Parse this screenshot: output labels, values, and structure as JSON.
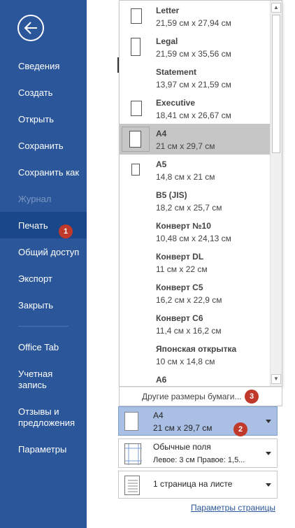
{
  "sidebar": {
    "items": [
      {
        "label": "Сведения"
      },
      {
        "label": "Создать"
      },
      {
        "label": "Открыть"
      },
      {
        "label": "Сохранить"
      },
      {
        "label": "Сохранить как"
      },
      {
        "label": "Журнал"
      },
      {
        "label": "Печать"
      },
      {
        "label": "Общий доступ"
      },
      {
        "label": "Экспорт"
      },
      {
        "label": "Закрыть"
      },
      {
        "label": "Office Tab"
      },
      {
        "label": "Учетная запись"
      },
      {
        "label": "Отзывы и предложения"
      },
      {
        "label": "Параметры"
      }
    ]
  },
  "badges": {
    "one": "1",
    "two": "2",
    "three": "3"
  },
  "paper_sizes": [
    {
      "name": "Letter",
      "size": "21,59 см x 27,94 см"
    },
    {
      "name": "Legal",
      "size": "21,59 см x 35,56 см"
    },
    {
      "name": "Statement",
      "size": "13,97 см x 21,59 см"
    },
    {
      "name": "Executive",
      "size": "18,41 см x 26,67 см"
    },
    {
      "name": "A4",
      "size": "21 см x 29,7 см"
    },
    {
      "name": "A5",
      "size": "14,8 см x 21 см"
    },
    {
      "name": "B5 (JIS)",
      "size": "18,2 см x 25,7 см"
    },
    {
      "name": "Конверт №10",
      "size": "10,48 см x 24,13 см"
    },
    {
      "name": "Конверт DL",
      "size": "11 см x 22 см"
    },
    {
      "name": "Конверт C5",
      "size": "16,2 см x 22,9 см"
    },
    {
      "name": "Конверт C6",
      "size": "11,4 см x 16,2 см"
    },
    {
      "name": "Японская открытка",
      "size": "10 см x 14,8 см"
    },
    {
      "name": "A6",
      "size": ""
    }
  ],
  "more_sizes_label": "Другие размеры бумаги...",
  "settings": {
    "paper": {
      "line1": "A4",
      "line2": "21 см x 29,7 см"
    },
    "margins": {
      "line1": "Обычные поля",
      "line2": "Левое:  3 см    Правое:  1,5..."
    },
    "pages_per_sheet": {
      "line1": "1 страница на листе"
    }
  },
  "page_setup_link": "Параметры страницы"
}
